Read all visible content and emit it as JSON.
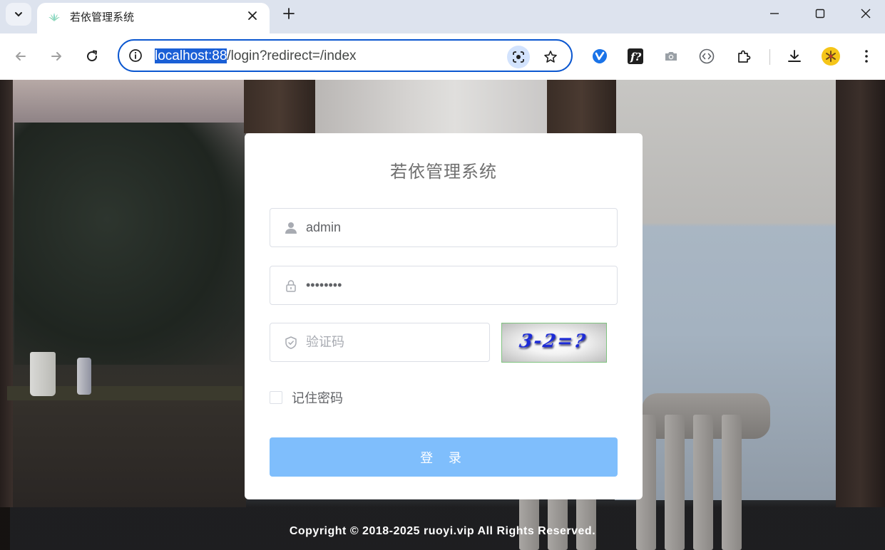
{
  "browser": {
    "tab_title": "若依管理系统",
    "url_host": "localhost:88",
    "url_path": "/login?redirect=/index"
  },
  "icons": {
    "tab_search": "chevron-down-icon",
    "favicon": "ruoyi-logo-icon",
    "tab_close": "close-icon",
    "new_tab": "plus-icon",
    "minimize": "minimize-icon",
    "maximize": "maximize-icon",
    "close_window": "close-icon",
    "back": "arrow-left-icon",
    "forward": "arrow-right-icon",
    "reload": "reload-icon",
    "site_info": "info-icon",
    "lens": "google-lens-icon",
    "bookmark": "star-icon",
    "extensions": [
      "v-extension-icon",
      "f-extension-icon",
      "camera-icon",
      "code-icon",
      "puzzle-icon"
    ],
    "download": "download-icon",
    "profile": "avatar-icon",
    "menu": "more-vertical-icon",
    "username": "user-icon",
    "password": "lock-icon",
    "captcha": "shield-icon"
  },
  "login": {
    "title": "若依管理系统",
    "username_value": "admin",
    "password_value": "admin123",
    "captcha_placeholder": "验证码",
    "captcha_text": "3-2=?",
    "remember_label": "记住密码",
    "remember_checked": false,
    "submit_label": "登 录"
  },
  "footer": {
    "copyright": "Copyright © 2018-2025 ruoyi.vip All Rights Reserved."
  },
  "colors": {
    "omnibox_border": "#0b57d0",
    "login_button": "#7fbefc",
    "captcha_text": "#1b2bd6"
  }
}
